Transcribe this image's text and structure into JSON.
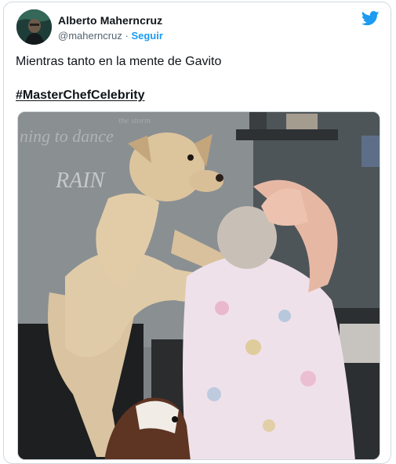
{
  "tweet": {
    "author_name": "Alberto Maherncruz",
    "handle": "@maherncruz",
    "separator": "·",
    "follow_label": "Seguir",
    "text": "Mientras tanto en la mente de Gavito",
    "hashtag": "#MasterChefCelebrity"
  },
  "media": {
    "wall_text_line1": "ning  to  dance",
    "wall_text_line2": "RAIN",
    "wall_text_top": "the  storm"
  },
  "colors": {
    "accent": "#1d9bf0",
    "text": "#0f1419",
    "secondary": "#536471",
    "border": "#cfd9de"
  },
  "icons": {
    "brand": "twitter-bird-icon"
  }
}
